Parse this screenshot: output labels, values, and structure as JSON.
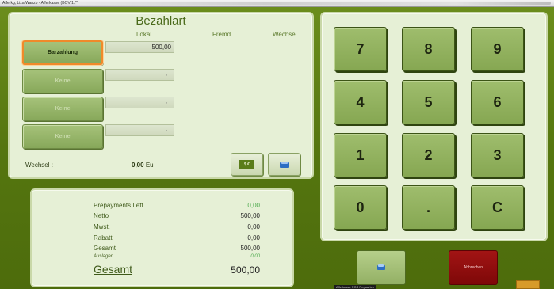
{
  "window": {
    "title": "Afferkg, Liza Wanzb - Afferkasse (BOV 1.0)"
  },
  "payment": {
    "title": "Bezahlart",
    "columns": {
      "lokal": "Lokal",
      "fremd": "Fremd",
      "wechsel": "Wechsel"
    },
    "methods": [
      {
        "label": "Barzahlung",
        "amount": "500,00",
        "active": true
      },
      {
        "label": "Keine",
        "amount": ",",
        "active": false
      },
      {
        "label": "Keine",
        "amount": ",",
        "active": false
      },
      {
        "label": "Keine",
        "amount": ",",
        "active": false
      }
    ],
    "wechsel_label": "Wechsel :",
    "wechsel_value": "0,00",
    "wechsel_currency": "Eu",
    "money_button_label": "$ €"
  },
  "totals": {
    "rows": [
      {
        "label": "Prepayments Left",
        "value": "0,00",
        "style": "green"
      },
      {
        "label": "Netto",
        "value": "500,00",
        "style": "normal"
      },
      {
        "label": "Mwst.",
        "value": "0,00",
        "style": "normal"
      },
      {
        "label": "Rabatt",
        "value": "0,00",
        "style": "normal"
      },
      {
        "label": "Gesamt",
        "value": "500,00",
        "style": "normal"
      },
      {
        "label": "Auslagen",
        "value": "0,00",
        "style": "small"
      }
    ],
    "grand_label": "Gesamt",
    "grand_value": "500,00"
  },
  "keypad": {
    "keys": [
      "7",
      "8",
      "9",
      "4",
      "5",
      "6",
      "1",
      "2",
      "3",
      "0",
      ".",
      "C"
    ]
  },
  "actions": {
    "cancel_label": "Abbrechen"
  },
  "status": {
    "label": "Afferkasse POS Reguarten"
  }
}
